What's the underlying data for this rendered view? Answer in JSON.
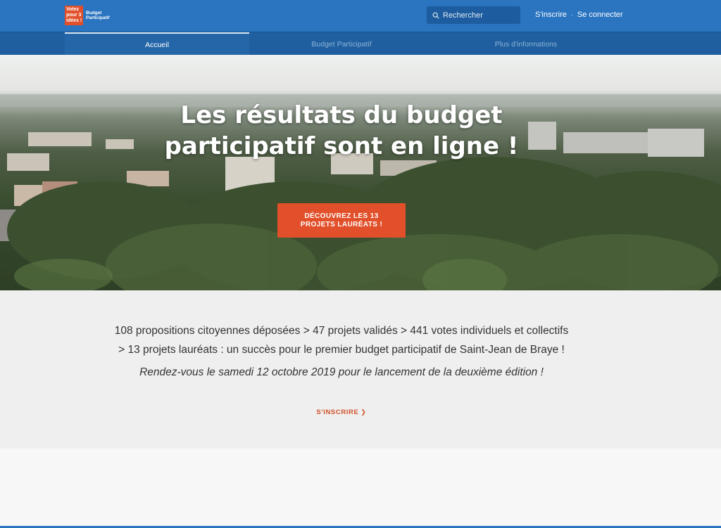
{
  "header": {
    "logo": {
      "box_text": "Votez\npour 3\nidées !",
      "label": "Budget\nParticipatif"
    },
    "search": {
      "placeholder": "Rechercher"
    },
    "auth": {
      "register": "S'inscrire",
      "separator": "·",
      "login": "Se connecter"
    }
  },
  "nav": {
    "tabs": [
      {
        "label": "Accueil",
        "active": true
      },
      {
        "label": "Budget Participatif",
        "active": false
      },
      {
        "label": "Plus d'informations",
        "active": false
      }
    ]
  },
  "hero": {
    "title": "Les résultats du budget participatif sont en ligne !",
    "button": "DÉCOUVREZ LES 13 PROJETS LAURÉATS !"
  },
  "stats": {
    "line1": "108 propositions citoyennes déposées > 47 projets validés > 441 votes individuels et collectifs",
    "line2": "> 13 projets lauréats : un succès pour le premier budget participatif de Saint-Jean de Braye !",
    "italic": "Rendez-vous le samedi 12 octobre 2019 pour le lancement de la deuxième édition !",
    "link": "S'INSCRIRE",
    "link_icon": "chevron-right-icon"
  },
  "colors": {
    "primary": "#2a74c0",
    "nav": "#1f5f9f",
    "accent": "#e1502a",
    "stats_bg": "#efefef"
  }
}
